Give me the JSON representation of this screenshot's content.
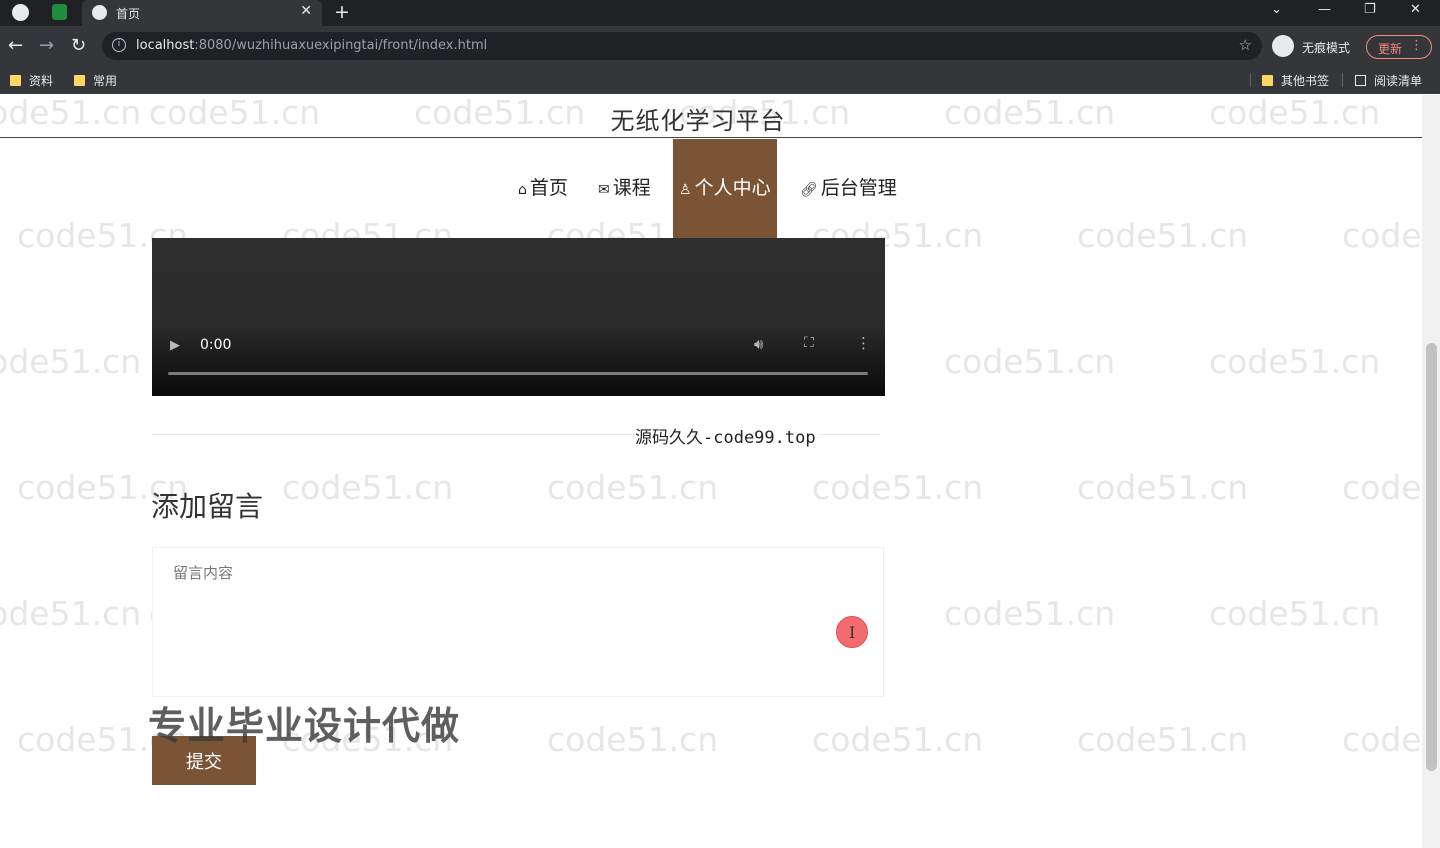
{
  "browser": {
    "tab_title": "首页",
    "new_tab_symbol": "+",
    "url_host": "localhost",
    "url_path": ":8080/wuzhihuaxuexipingtai/front/index.html",
    "incognito_label": "无痕模式",
    "update_label": "更新",
    "bookmarks": [
      "资料",
      "常用"
    ],
    "other_bookmarks": "其他书签",
    "reading_list": "阅读清单"
  },
  "site": {
    "title": "无纸化学习平台",
    "nav": [
      {
        "label": "首页",
        "icon": "home-icon"
      },
      {
        "label": "课程",
        "icon": "mail-icon"
      },
      {
        "label": "个人中心",
        "icon": "user-icon"
      },
      {
        "label": "后台管理",
        "icon": "link-icon"
      }
    ],
    "active_nav": "个人中心"
  },
  "video": {
    "time": "0:00",
    "progress": 0
  },
  "caption": "源码久久-code99.top",
  "message": {
    "section_title": "添加留言",
    "placeholder": "留言内容",
    "submit_label": "提交"
  },
  "promo": "专业毕业设计代做",
  "watermark": "code51.cn",
  "colors": {
    "accent": "#7a5434"
  }
}
